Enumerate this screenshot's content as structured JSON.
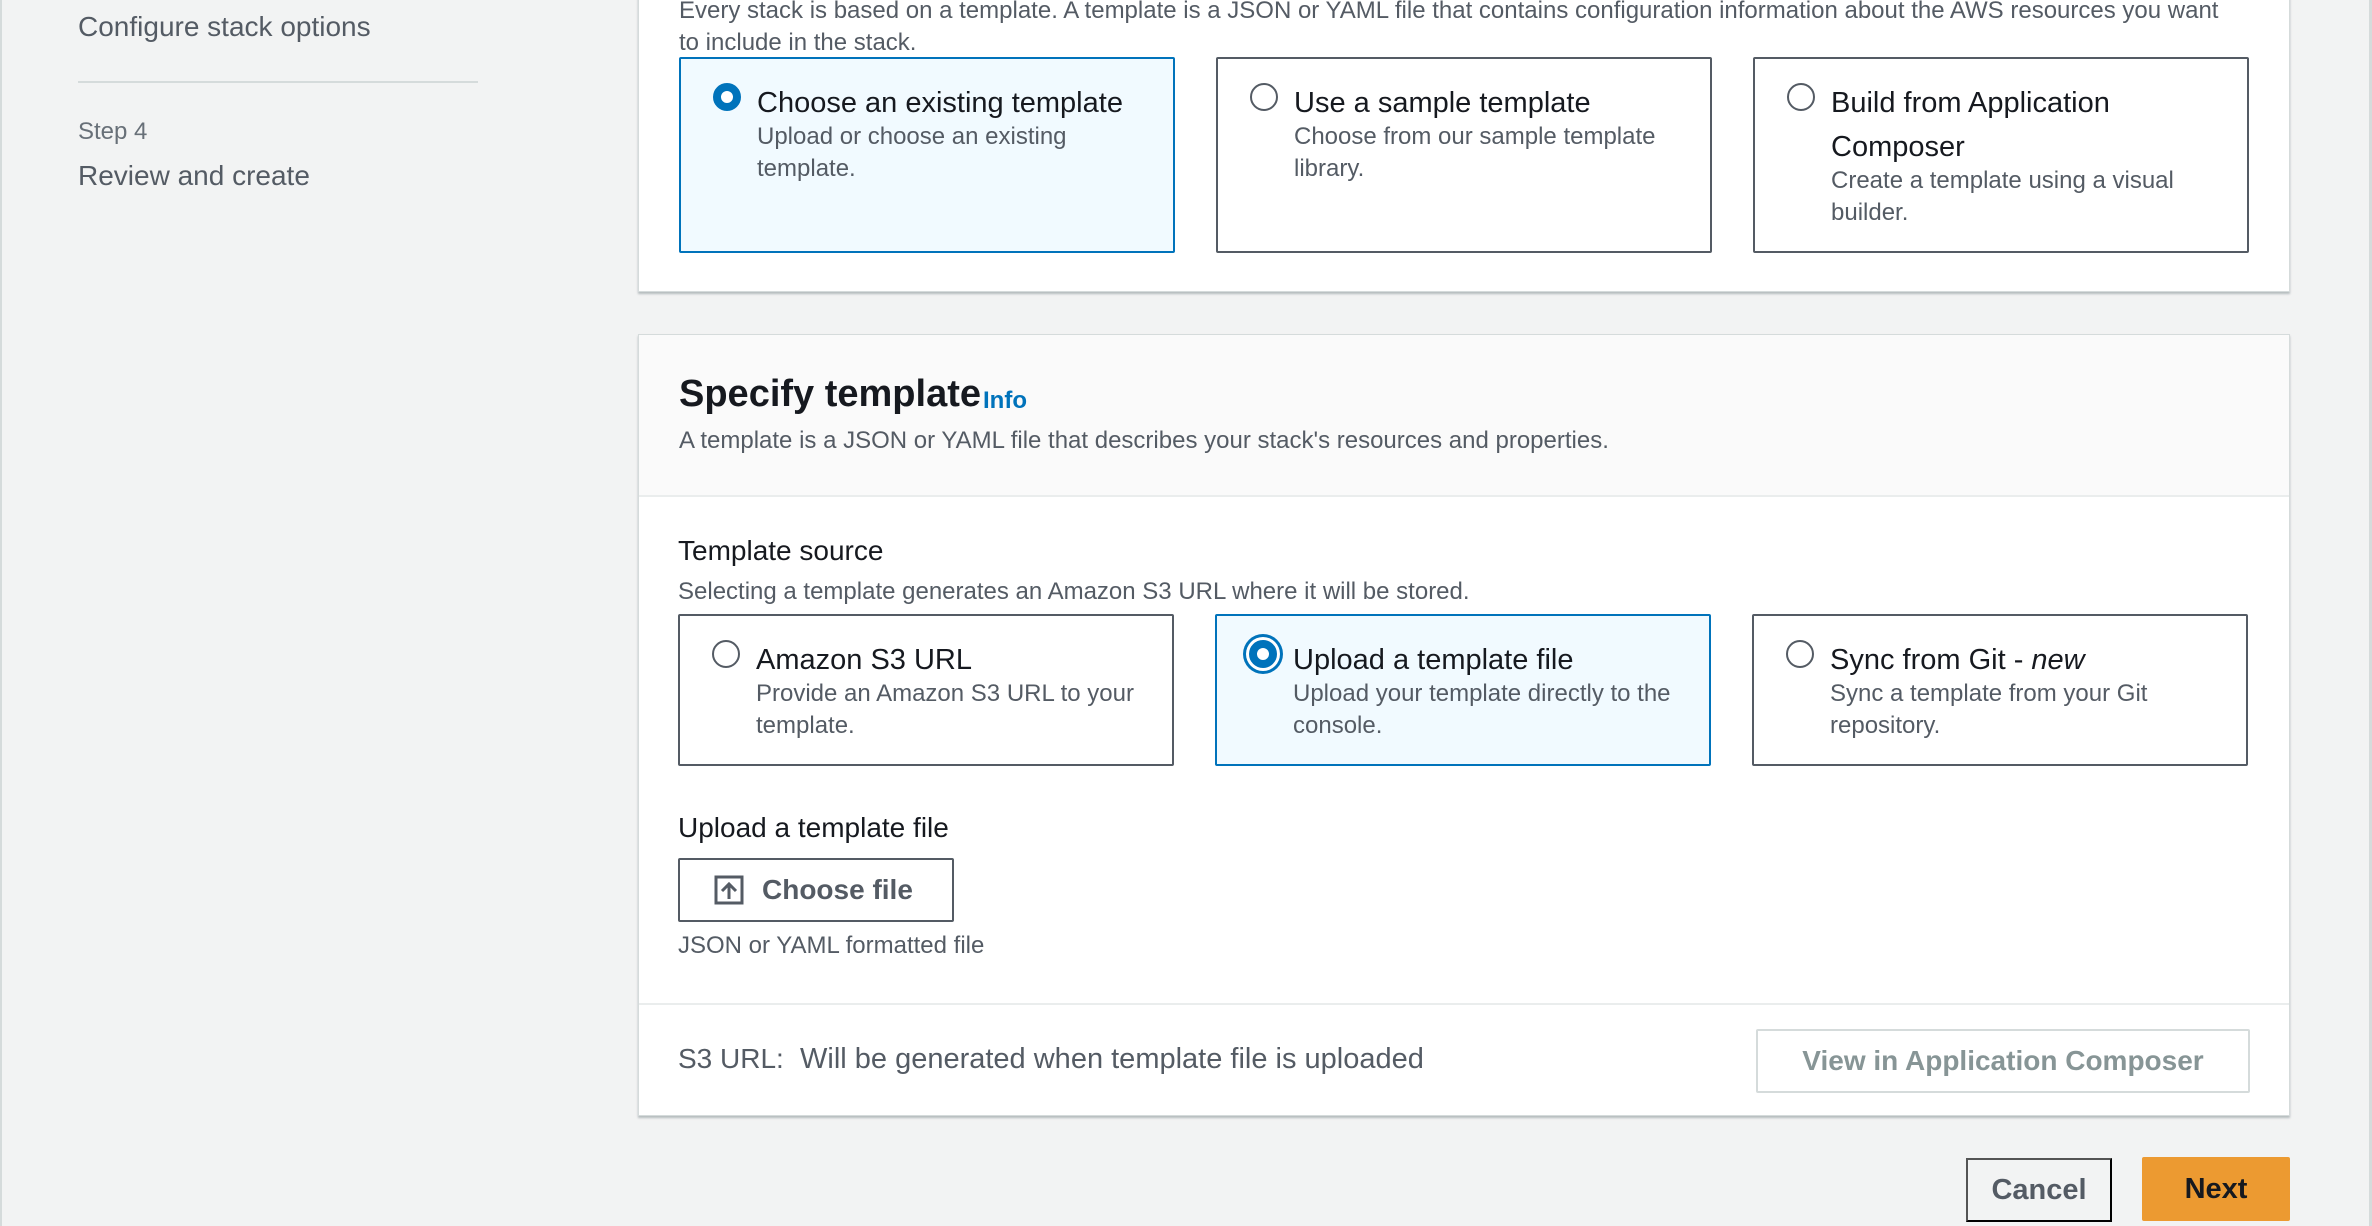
{
  "sidebar": {
    "step3_title": "Configure stack options",
    "step4_label": "Step 4",
    "step4_title": "Review and create"
  },
  "prerequisite": {
    "description": "Every stack is based on a template. A template is a JSON or YAML file that contains configuration information about the AWS resources you want to include in the stack.",
    "options": [
      {
        "title": "Choose an existing template",
        "description": "Upload or choose an existing template.",
        "selected": true
      },
      {
        "title": "Use a sample template",
        "description": "Choose from our sample template library.",
        "selected": false
      },
      {
        "title": "Build from Application Composer",
        "description": "Create a template using a visual builder.",
        "selected": false
      }
    ]
  },
  "specify_template": {
    "heading": "Specify template",
    "info_link": "Info",
    "description": "A template is a JSON or YAML file that describes your stack's resources and properties.",
    "source_label": "Template source",
    "source_description": "Selecting a template generates an Amazon S3 URL where it will be stored.",
    "sources": [
      {
        "title": "Amazon S3 URL",
        "title_suffix": "",
        "description": "Provide an Amazon S3 URL to your template.",
        "selected": false
      },
      {
        "title": "Upload a template file",
        "title_suffix": "",
        "description": "Upload your template directly to the console.",
        "selected": true
      },
      {
        "title": "Sync from Git - ",
        "title_suffix": "new",
        "description": "Sync a template from your Git repository.",
        "selected": false
      }
    ],
    "upload_label": "Upload a template file",
    "choose_file_button": "Choose file",
    "upload_hint": "JSON or YAML formatted file",
    "s3_url_label": "S3 URL:",
    "s3_url_value": "Will be generated when template file is uploaded",
    "view_composer_button": "View in Application Composer"
  },
  "footer": {
    "cancel_button": "Cancel",
    "next_button": "Next"
  },
  "colors": {
    "accent": "#0073bb",
    "primary_button": "#ec9a31",
    "page_background": "#f2f3f3"
  },
  "icons": [
    "upload-icon",
    "radio-checked-icon",
    "radio-unchecked-icon"
  ]
}
